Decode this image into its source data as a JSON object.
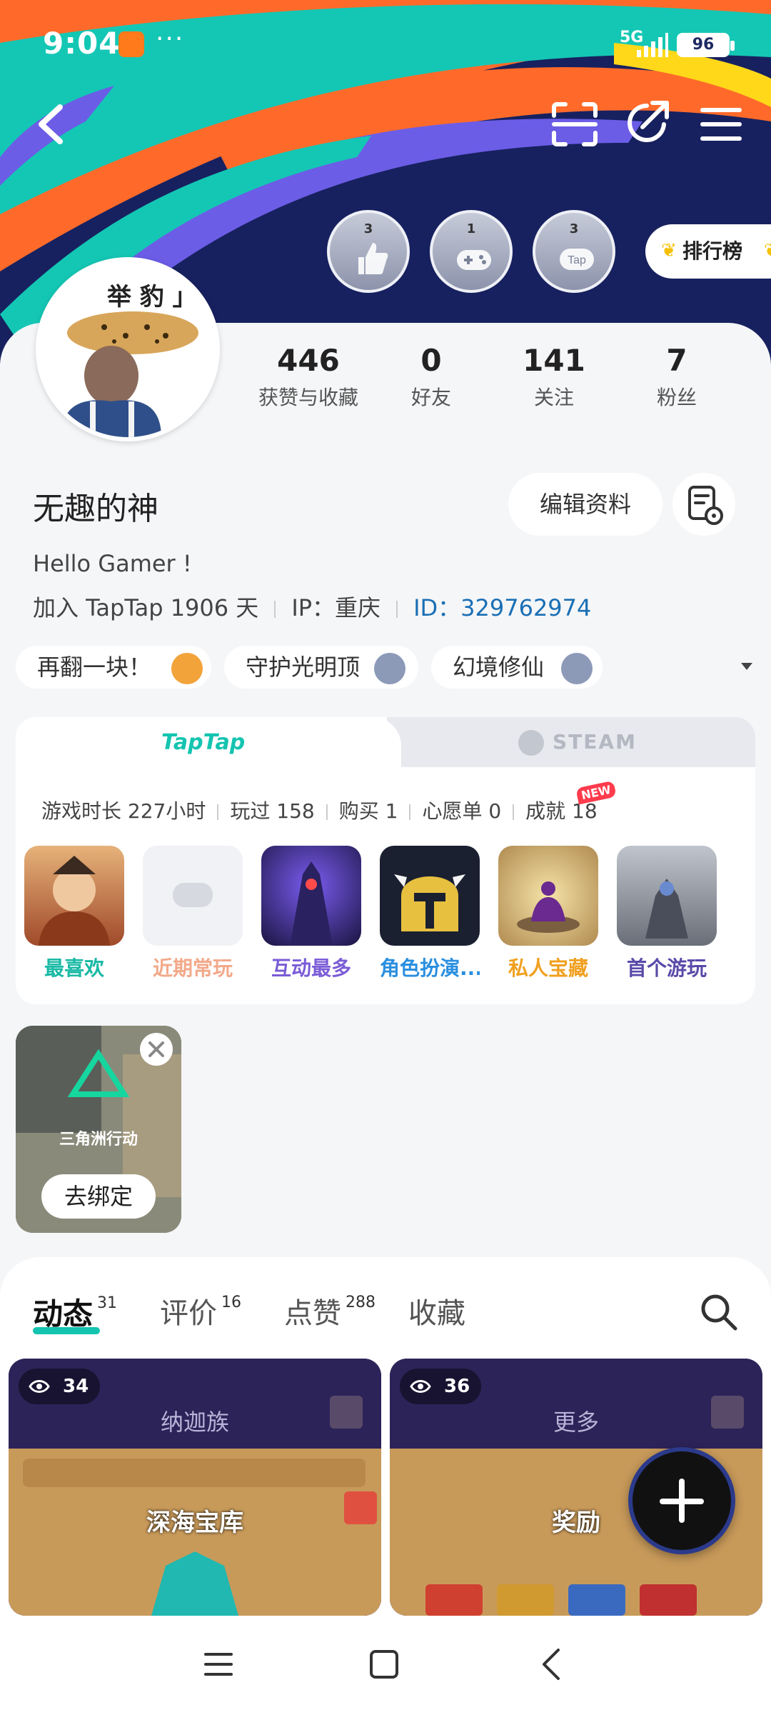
{
  "status_bar": {
    "time": "9:04",
    "network": "5G",
    "battery": "96"
  },
  "badges": [
    {
      "count": "3",
      "icon": "thumbs-up-icon"
    },
    {
      "count": "1",
      "icon": "gamepad-icon"
    },
    {
      "count": "3",
      "icon": "tap-icon"
    }
  ],
  "ranking_label": "排行榜",
  "avatar_caption": "举 豹 」",
  "stats": [
    {
      "value": "446",
      "label": "获赞与收藏"
    },
    {
      "value": "0",
      "label": "好友"
    },
    {
      "value": "141",
      "label": "关注"
    },
    {
      "value": "7",
      "label": "粉丝"
    }
  ],
  "profile": {
    "username": "无趣的神",
    "edit_label": "编辑资料",
    "bio": "Hello Gamer !",
    "joined": "加入 TapTap 1906 天",
    "ip": "IP：重庆",
    "id": "ID：329762974"
  },
  "tags": [
    {
      "label": "再翻一块！",
      "level": "6",
      "color": "#f2a33a"
    },
    {
      "label": "守护光明顶",
      "level": "2",
      "color": "#8c9ab8"
    },
    {
      "label": "幻境修仙",
      "level": "2",
      "color": "#8c9ab8"
    }
  ],
  "game_panel": {
    "tab_taptap": "TapTap",
    "tab_steam": "STEAM",
    "stats": [
      "游戏时长 227小时",
      "玩过 158",
      "购买 1",
      "心愿单 0",
      "成就 18"
    ],
    "new_badge": "NEW",
    "tiles": [
      {
        "label": "最喜欢",
        "color": "#18b9a4"
      },
      {
        "label": "近期常玩",
        "color": "#f2a98a"
      },
      {
        "label": "互动最多",
        "color": "#7a5cd6"
      },
      {
        "label": "角色扮演...",
        "color": "#2a8fe0"
      },
      {
        "label": "私人宝藏",
        "color": "#f0a020"
      },
      {
        "label": "首个游玩",
        "color": "#5a4aa8"
      }
    ]
  },
  "bound_game": {
    "logo_text": "三角洲行动",
    "unbind_label": "去绑定"
  },
  "content_tabs": [
    {
      "label": "动态",
      "count": "31"
    },
    {
      "label": "评价",
      "count": "16"
    },
    {
      "label": "点赞",
      "count": "288"
    },
    {
      "label": "收藏",
      "count": ""
    }
  ],
  "posts": [
    {
      "views": "34",
      "title": "纳迦族",
      "subtitle": "深海宝库"
    },
    {
      "views": "36",
      "title": "更多",
      "subtitle": "奖励"
    }
  ]
}
